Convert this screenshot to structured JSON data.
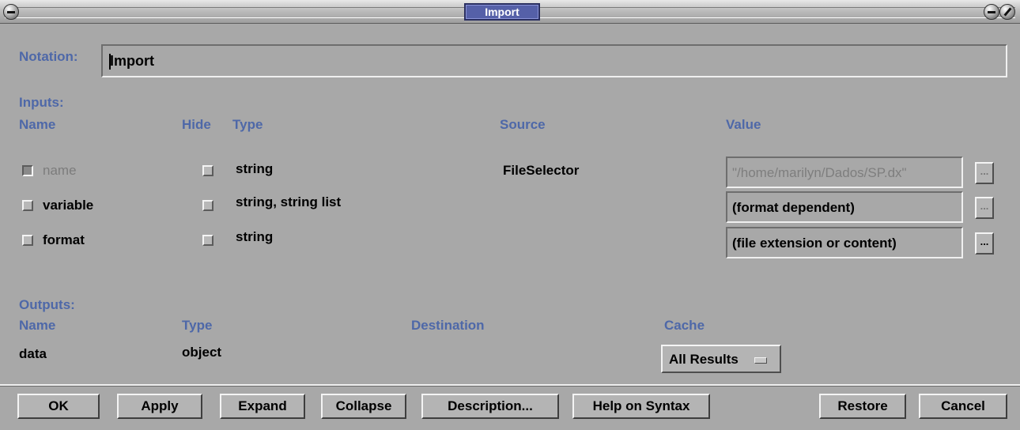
{
  "window": {
    "title": "Import"
  },
  "notation": {
    "label": "Notation:",
    "value": "Import"
  },
  "inputs": {
    "section_label": "Inputs:",
    "headers": {
      "name": "Name",
      "hide": "Hide",
      "type": "Type",
      "source": "Source",
      "value": "Value"
    },
    "rows": [
      {
        "name": "name",
        "checked": true,
        "enabled": false,
        "type": "string",
        "source": "FileSelector",
        "value": "\"/home/marilyn/Dados/SP.dx\"",
        "value_enabled": false,
        "button": "..."
      },
      {
        "name": "variable",
        "checked": false,
        "enabled": true,
        "type": "string, string list",
        "source": "",
        "value": "(format dependent)",
        "value_enabled": true,
        "button": "..."
      },
      {
        "name": "format",
        "checked": false,
        "enabled": true,
        "type": "string",
        "source": "",
        "value": "(file extension or content)",
        "value_enabled": true,
        "button": "..."
      }
    ]
  },
  "outputs": {
    "section_label": "Outputs:",
    "headers": {
      "name": "Name",
      "type": "Type",
      "destination": "Destination",
      "cache": "Cache"
    },
    "rows": [
      {
        "name": "data",
        "type": "object",
        "destination": "",
        "cache": "All Results"
      }
    ]
  },
  "buttons": {
    "ok": "OK",
    "apply": "Apply",
    "expand": "Expand",
    "collapse": "Collapse",
    "description": "Description...",
    "help": "Help on Syntax",
    "restore": "Restore",
    "cancel": "Cancel"
  },
  "colors": {
    "label": "#4e68a8",
    "background": "#a8a8a8",
    "title_bg": "#5560a8"
  }
}
